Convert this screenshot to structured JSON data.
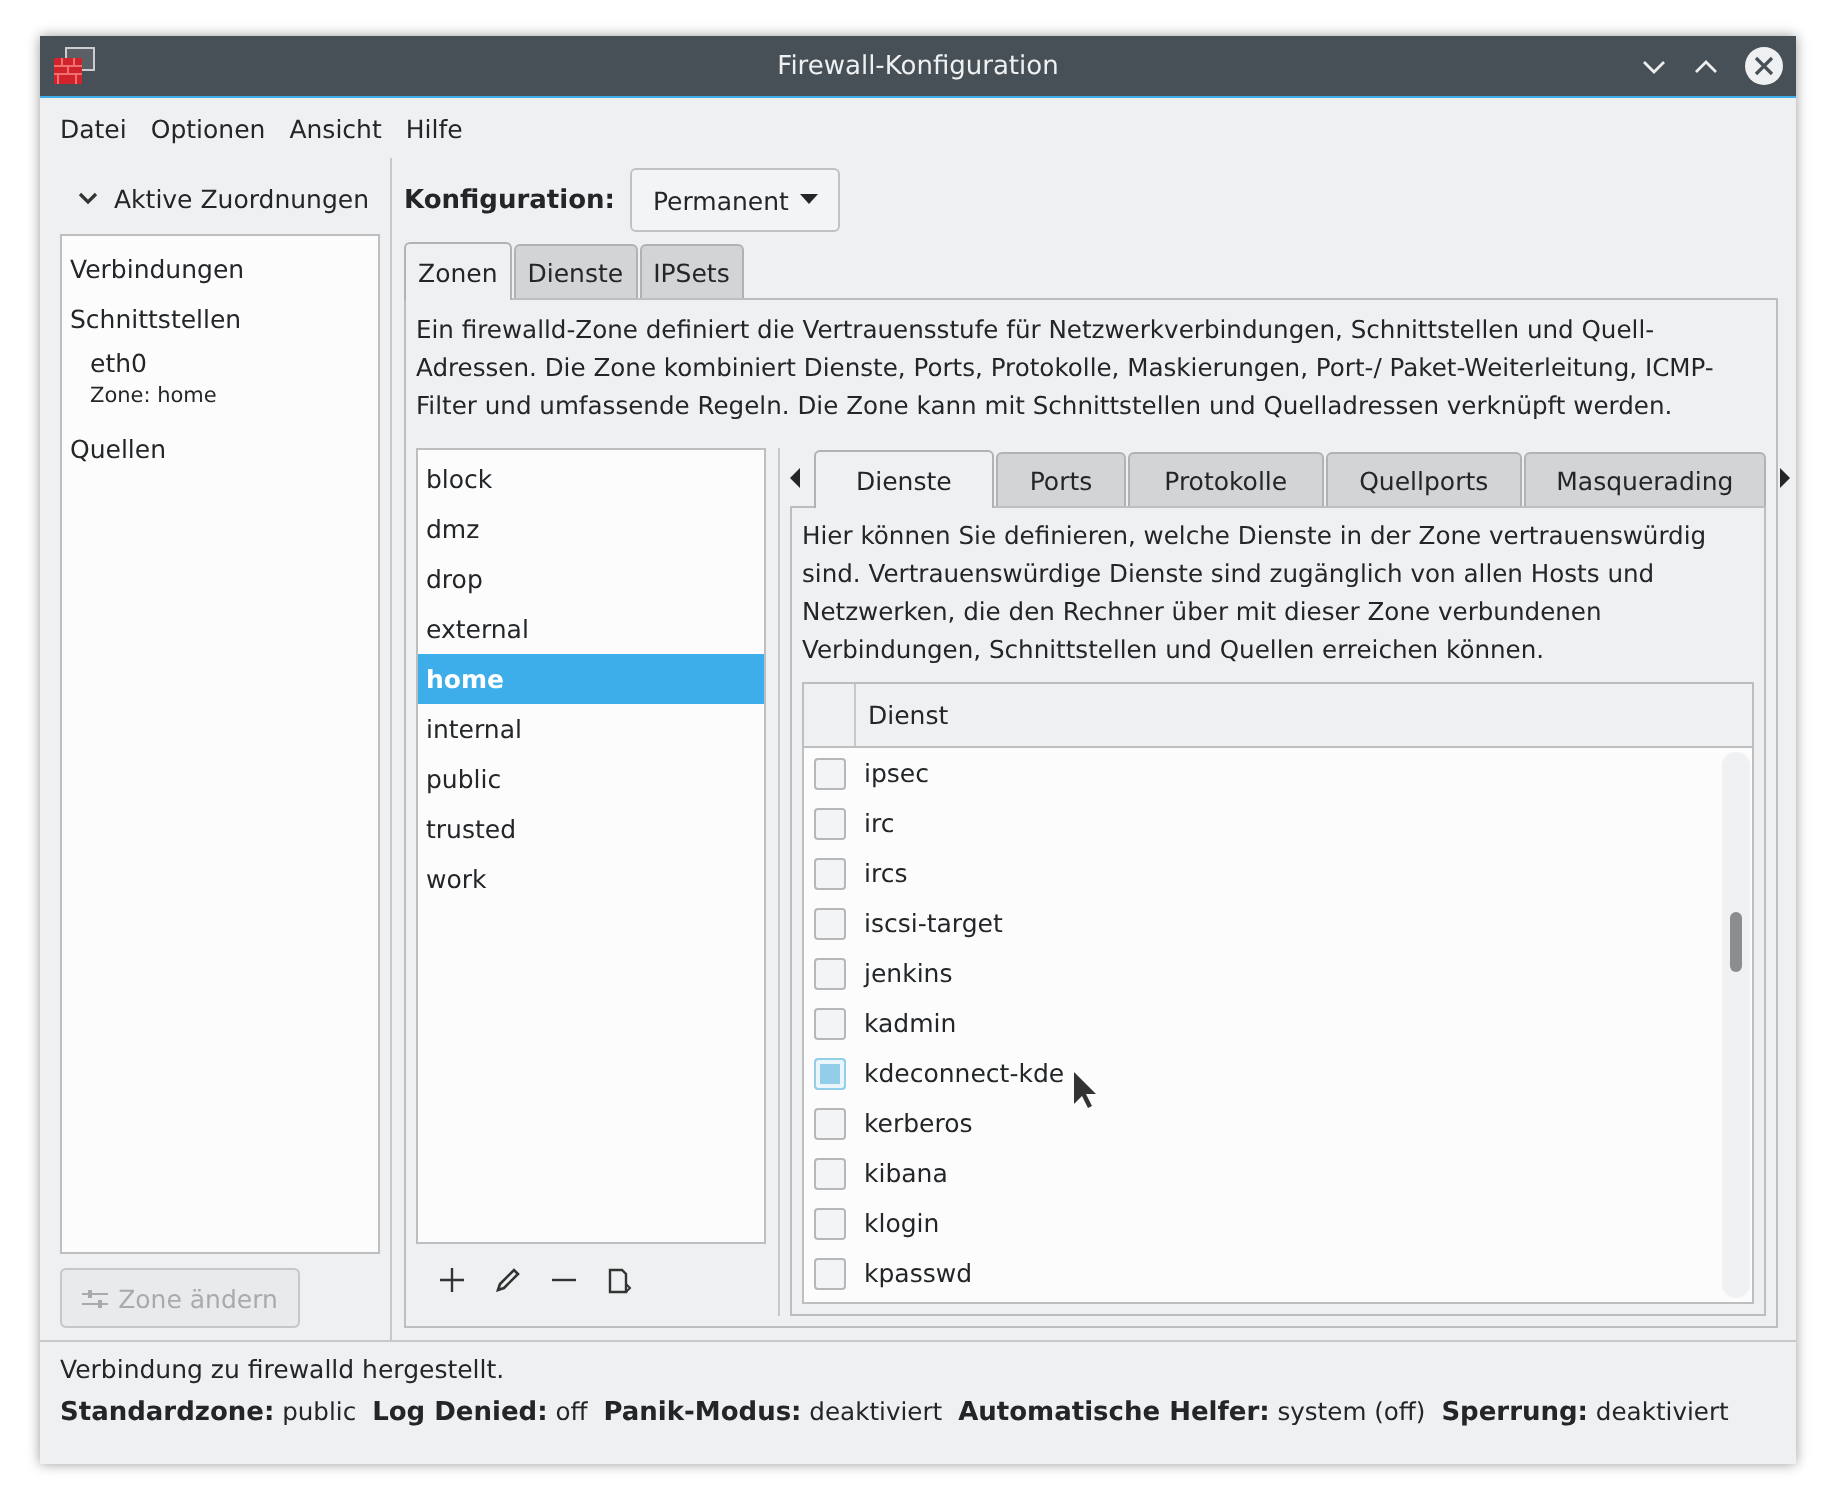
{
  "window": {
    "title": "Firewall-Konfiguration"
  },
  "menu": [
    "Datei",
    "Optionen",
    "Ansicht",
    "Hilfe"
  ],
  "sidebar": {
    "header": "Aktive Zuordnungen",
    "expanded": true,
    "items": [
      {
        "kind": "group",
        "label": "Verbindungen"
      },
      {
        "kind": "group",
        "label": "Schnittstellen"
      },
      {
        "kind": "entry",
        "label": "eth0",
        "sub": "Zone: home"
      },
      {
        "kind": "group",
        "label": "Quellen"
      }
    ],
    "button": {
      "label": "Zone ändern",
      "disabled": true
    }
  },
  "configuration": {
    "label": "Konfiguration:",
    "value": "Permanent"
  },
  "tabs": [
    {
      "label": "Zonen",
      "selected": true
    },
    {
      "label": "Dienste",
      "selected": false
    },
    {
      "label": "IPSets",
      "selected": false
    }
  ],
  "zone_description": "Ein firewalld-Zone definiert die Vertrauensstufe für Netzwerkverbindungen, Schnittstellen und Quell-Adressen. Die Zone kombiniert Dienste, Ports, Protokolle, Maskierungen, Port-/ Paket-Weiterleitung, ICMP-Filter und umfassende Regeln. Die Zone kann mit Schnittstellen und Quelladressen verknüpft werden.",
  "zones": [
    {
      "name": "block",
      "selected": false
    },
    {
      "name": "dmz",
      "selected": false
    },
    {
      "name": "drop",
      "selected": false
    },
    {
      "name": "external",
      "selected": false
    },
    {
      "name": "home",
      "selected": true
    },
    {
      "name": "internal",
      "selected": false
    },
    {
      "name": "public",
      "selected": false
    },
    {
      "name": "trusted",
      "selected": false
    },
    {
      "name": "work",
      "selected": false
    }
  ],
  "zone_tabs": [
    {
      "label": "Dienste",
      "selected": true
    },
    {
      "label": "Ports",
      "selected": false
    },
    {
      "label": "Protokolle",
      "selected": false
    },
    {
      "label": "Quellports",
      "selected": false
    },
    {
      "label": "Masquerading",
      "selected": false
    }
  ],
  "services_description": "Hier können Sie definieren, welche Dienste in der Zone vertrauenswürdig sind. Vertrauenswürdige Dienste sind zugänglich von allen Hosts und Netzwerken, die den Rechner über mit dieser Zone verbundenen Verbindungen, Schnittstellen und Quellen erreichen können.",
  "services_table": {
    "columns": [
      "Dienst"
    ],
    "rows": [
      {
        "name": "ipsec",
        "checked": false,
        "hovered": false
      },
      {
        "name": "irc",
        "checked": false,
        "hovered": false
      },
      {
        "name": "ircs",
        "checked": false,
        "hovered": false
      },
      {
        "name": "iscsi-target",
        "checked": false,
        "hovered": false
      },
      {
        "name": "jenkins",
        "checked": false,
        "hovered": false
      },
      {
        "name": "kadmin",
        "checked": false,
        "hovered": false
      },
      {
        "name": "kdeconnect-kde",
        "checked": false,
        "hovered": true
      },
      {
        "name": "kerberos",
        "checked": false,
        "hovered": false
      },
      {
        "name": "kibana",
        "checked": false,
        "hovered": false
      },
      {
        "name": "klogin",
        "checked": false,
        "hovered": false
      },
      {
        "name": "kpasswd",
        "checked": false,
        "hovered": false
      }
    ]
  },
  "status_bar": {
    "message": "Verbindung zu firewalld hergestellt.",
    "fields": [
      {
        "label": "Standardzone:",
        "value": "public"
      },
      {
        "label": "Log Denied:",
        "value": "off"
      },
      {
        "label": "Panik-Modus:",
        "value": "deaktiviert"
      },
      {
        "label": "Automatische Helfer:",
        "value": "system (off)"
      },
      {
        "label": "Sperrung:",
        "value": "deaktiviert"
      }
    ]
  }
}
